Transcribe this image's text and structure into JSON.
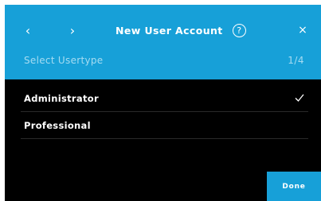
{
  "header": {
    "back_icon": "chevron-left-icon",
    "back_glyph": "‹",
    "forward_icon": "chevron-right-icon",
    "forward_glyph": "›",
    "title": "New User Account",
    "help_icon": "question-circle-icon",
    "help_glyph": "?",
    "close_icon": "close-icon",
    "close_glyph": "×",
    "subtitle": "Select Usertype",
    "step": "1/4"
  },
  "user_types": [
    {
      "label": "Administrator",
      "selected": true,
      "icon": "checkmark-icon"
    },
    {
      "label": "Professional",
      "selected": false
    }
  ],
  "footer": {
    "done_label": "Done"
  },
  "colors": {
    "accent": "#17a0d8",
    "background": "#000000",
    "subtle_text": "#a6dcf2",
    "text": "#ffffff"
  }
}
